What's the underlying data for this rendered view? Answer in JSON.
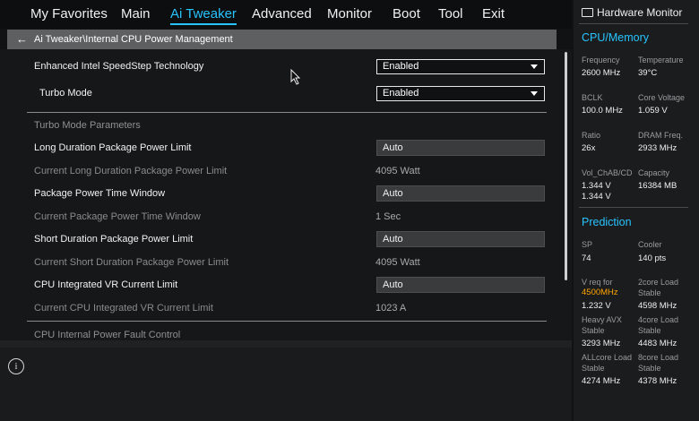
{
  "menu": {
    "items": [
      {
        "label": "My Favorites"
      },
      {
        "label": "Main"
      },
      {
        "label": "Ai Tweaker"
      },
      {
        "label": "Advanced"
      },
      {
        "label": "Monitor"
      },
      {
        "label": "Boot"
      },
      {
        "label": "Tool"
      },
      {
        "label": "Exit"
      }
    ],
    "active": "Ai Tweaker"
  },
  "breadcrumb": {
    "text": "Ai Tweaker\\Internal CPU Power Management"
  },
  "settings": {
    "speedstep": {
      "label": "Enhanced Intel SpeedStep Technology",
      "value": "Enabled"
    },
    "turbo_mode": {
      "label": "Turbo Mode",
      "value": "Enabled"
    },
    "turbo_section": "Turbo Mode Parameters",
    "long_limit": {
      "label": "Long Duration Package Power Limit",
      "value": "Auto"
    },
    "current_long": {
      "label": "Current Long Duration Package Power Limit",
      "value": "4095 Watt"
    },
    "time_window": {
      "label": "Package Power Time Window",
      "value": "Auto"
    },
    "current_time_window": {
      "label": "Current Package Power Time Window",
      "value": "1 Sec"
    },
    "short_limit": {
      "label": "Short Duration Package Power Limit",
      "value": "Auto"
    },
    "current_short": {
      "label": "Current Short Duration Package Power Limit",
      "value": "4095 Watt"
    },
    "vr_limit": {
      "label": "CPU Integrated VR Current Limit",
      "value": "Auto"
    },
    "current_vr": {
      "label": "Current CPU Integrated VR Current Limit",
      "value": "1023 A"
    },
    "fault_section": "CPU Internal Power Fault Control"
  },
  "hardware_monitor": {
    "title": "Hardware Monitor",
    "cpu_memory": {
      "heading": "CPU/Memory",
      "frequency": {
        "label": "Frequency",
        "value": "2600 MHz"
      },
      "temperature": {
        "label": "Temperature",
        "value": "39°C"
      },
      "bclk": {
        "label": "BCLK",
        "value": "100.0 MHz"
      },
      "core_voltage": {
        "label": "Core Voltage",
        "value": "1.059 V"
      },
      "ratio": {
        "label": "Ratio",
        "value": "26x"
      },
      "dram_freq": {
        "label": "DRAM Freq.",
        "value": "2933 MHz"
      },
      "vol_chab": {
        "label": "Vol_ChAB/CD",
        "value1": "1.344 V",
        "value2": "1.344 V"
      },
      "capacity": {
        "label": "Capacity",
        "value": "16384 MB"
      }
    },
    "prediction": {
      "heading": "Prediction",
      "sp": {
        "label": "SP",
        "value": "74"
      },
      "cooler": {
        "label": "Cooler",
        "value": "140 pts"
      },
      "vreq": {
        "label": "V req for",
        "freq": "4500MHz",
        "value": "1.232 V"
      },
      "two_core": {
        "label1": "2core Load",
        "label2": "Stable",
        "value": "4598 MHz"
      },
      "heavy_avx": {
        "label1": "Heavy AVX",
        "label2": "Stable",
        "value": "3293 MHz"
      },
      "four_core": {
        "label1": "4core Load",
        "label2": "Stable",
        "value": "4483 MHz"
      },
      "allcore": {
        "label1": "ALLcore Load",
        "label2": "Stable",
        "value": "4274 MHz"
      },
      "eight_core": {
        "label1": "8core Load",
        "label2": "Stable",
        "value": "4378 MHz"
      }
    }
  },
  "colors": {
    "accent": "#27c4ff",
    "highlight": "#ffa400",
    "background": "#161719"
  },
  "icons": {
    "back": "left-arrow-icon",
    "info": "info-icon",
    "monitor": "monitor-icon",
    "cursor": "mouse-pointer-icon"
  }
}
